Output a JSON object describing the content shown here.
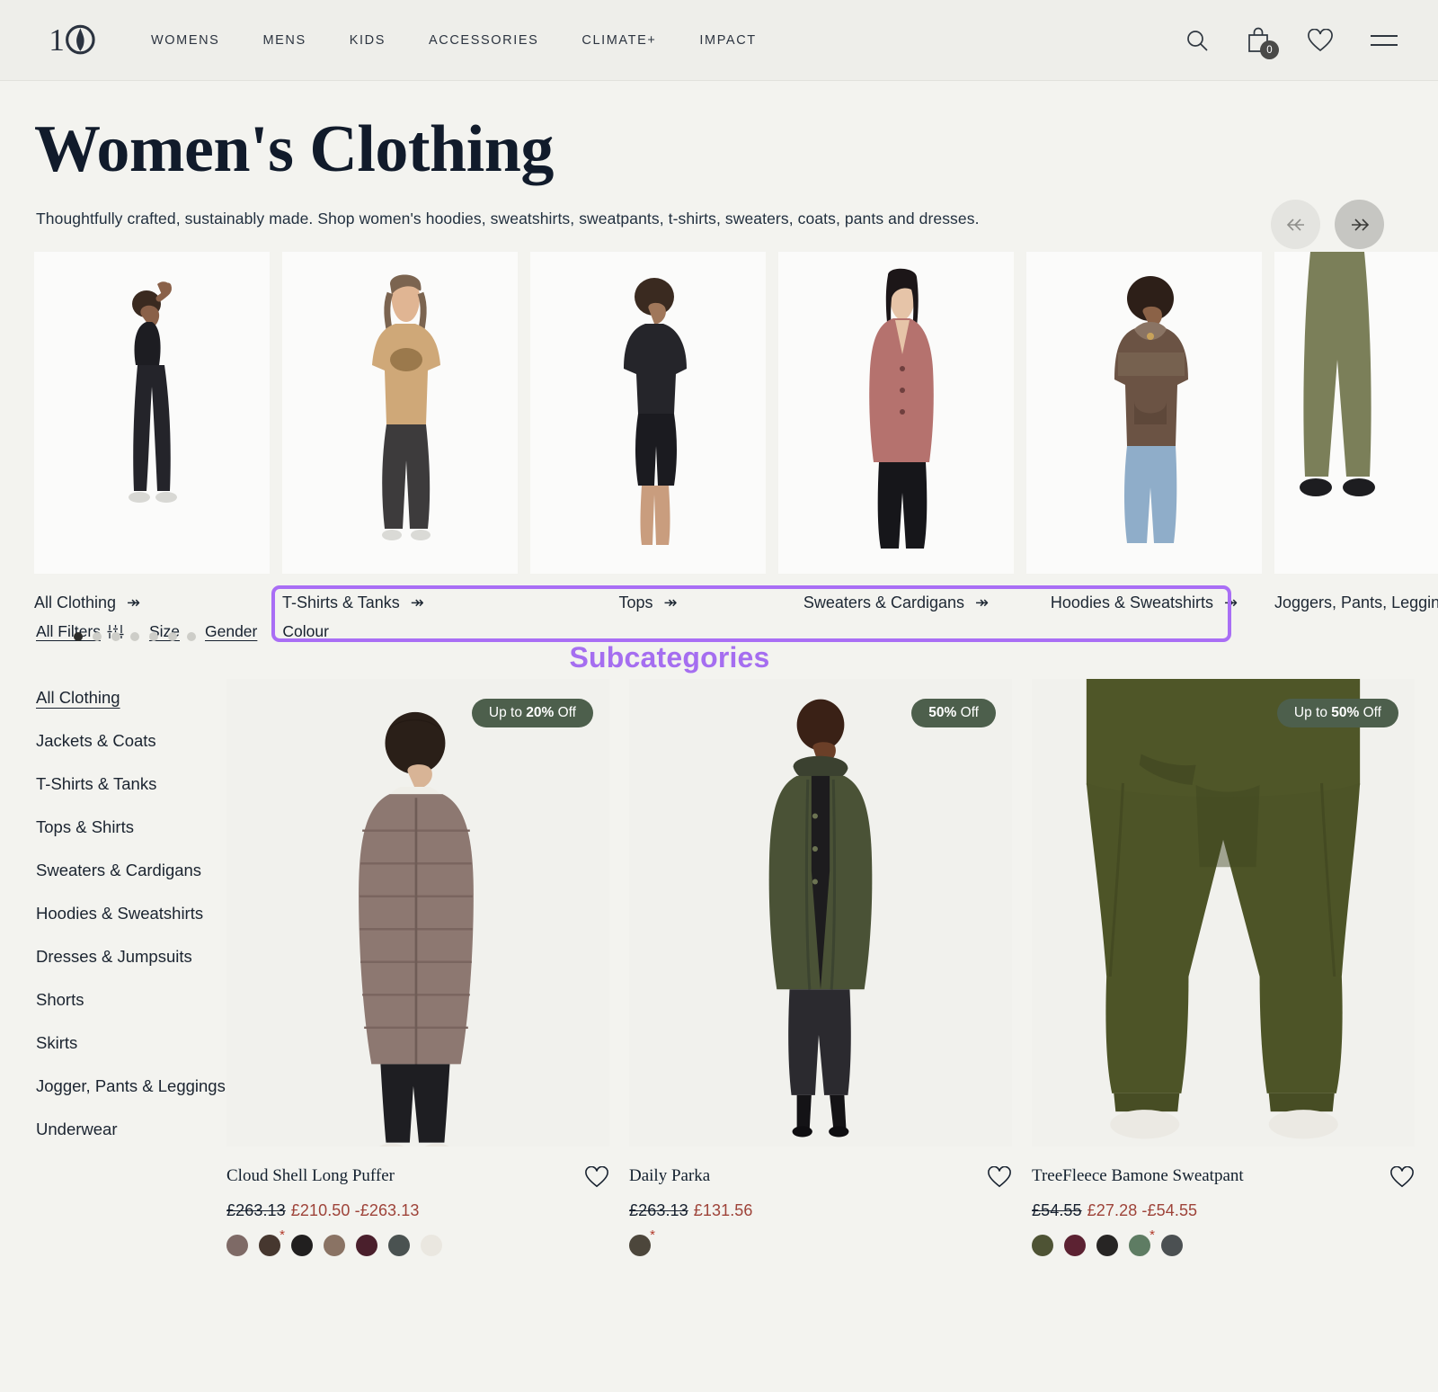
{
  "header": {
    "logo_name": "ten-tree-logo",
    "nav": [
      {
        "label": "WOMENS"
      },
      {
        "label": "MENS"
      },
      {
        "label": "KIDS"
      },
      {
        "label": "ACCESSORIES"
      },
      {
        "label": "CLIMATE+"
      },
      {
        "label": "IMPACT"
      }
    ],
    "icons": {
      "search": "search-icon",
      "bag": "shopping-bag-icon",
      "bag_count": "0",
      "wishlist": "heart-icon",
      "menu": "hamburger-menu-icon"
    }
  },
  "page": {
    "title": "Women's Clothing",
    "subtitle": "Thoughtfully crafted, sustainably made. Shop women's hoodies, sweatshirts, sweatpants, t-shirts, sweaters, coats, pants and dresses."
  },
  "carousel": {
    "prev_icon": "double-chevron-left-icon",
    "next_icon": "double-chevron-right-icon",
    "tiles": [
      {
        "label": "All Clothing",
        "arrow": "↠"
      },
      {
        "label": "T-Shirts & Tanks",
        "arrow": "↠"
      },
      {
        "label": "Tops",
        "arrow": "↠"
      },
      {
        "label": "Sweaters & Cardigans",
        "arrow": "↠"
      },
      {
        "label": "Hoodies & Sweatshirts",
        "arrow": "↠"
      },
      {
        "label": "Joggers, Pants, Leggings",
        "arrow": "↠"
      }
    ],
    "dots": 7,
    "active_dot": 0
  },
  "annotation": {
    "label": "Subcategories",
    "color": "#a56ef0"
  },
  "filters": [
    {
      "label": "All Filters",
      "icon": "sliders-icon"
    },
    {
      "label": "Size",
      "icon": ""
    },
    {
      "label": "Gender",
      "icon": ""
    },
    {
      "label": "Colour",
      "icon": ""
    }
  ],
  "sidebar": {
    "items": [
      {
        "label": "All Clothing",
        "active": true
      },
      {
        "label": "Jackets & Coats",
        "active": false
      },
      {
        "label": "T-Shirts & Tanks",
        "active": false
      },
      {
        "label": "Tops & Shirts",
        "active": false
      },
      {
        "label": "Sweaters & Cardigans",
        "active": false
      },
      {
        "label": "Hoodies & Sweatshirts",
        "active": false
      },
      {
        "label": "Dresses & Jumpsuits",
        "active": false
      },
      {
        "label": "Shorts",
        "active": false
      },
      {
        "label": "Skirts",
        "active": false
      },
      {
        "label": "Jogger, Pants & Leggings",
        "active": false
      },
      {
        "label": "Underwear",
        "active": false
      }
    ]
  },
  "products": [
    {
      "name": "Cloud Shell Long Puffer",
      "badge_prefix": "Up to ",
      "badge_strong": "20%",
      "badge_suffix": " Off",
      "price_old": "£263.13",
      "price_new": "£210.50 -£263.13",
      "swatches": [
        "#7e6a66",
        "#46372f",
        "#211f1f",
        "#8a7364",
        "#4a1f2c",
        "#4a5251",
        "#eae7e0"
      ],
      "swatch_asterisk": 1,
      "heart": "heart-icon"
    },
    {
      "name": "Daily Parka",
      "badge_prefix": "",
      "badge_strong": "50%",
      "badge_suffix": " Off",
      "price_old": "£263.13",
      "price_new": "£131.56",
      "swatches": [
        "#4c463b"
      ],
      "swatch_asterisk": 0,
      "heart": "heart-icon"
    },
    {
      "name": "TreeFleece Bamone Sweatpant",
      "badge_prefix": "Up to ",
      "badge_strong": "50%",
      "badge_suffix": " Off",
      "price_old": "£54.55",
      "price_new": "£27.28 -£54.55",
      "swatches": [
        "#4e5334",
        "#5c2232",
        "#272524",
        "#5e7c63",
        "#4b5052"
      ],
      "swatch_asterisk": 3,
      "heart": "heart-icon"
    }
  ]
}
